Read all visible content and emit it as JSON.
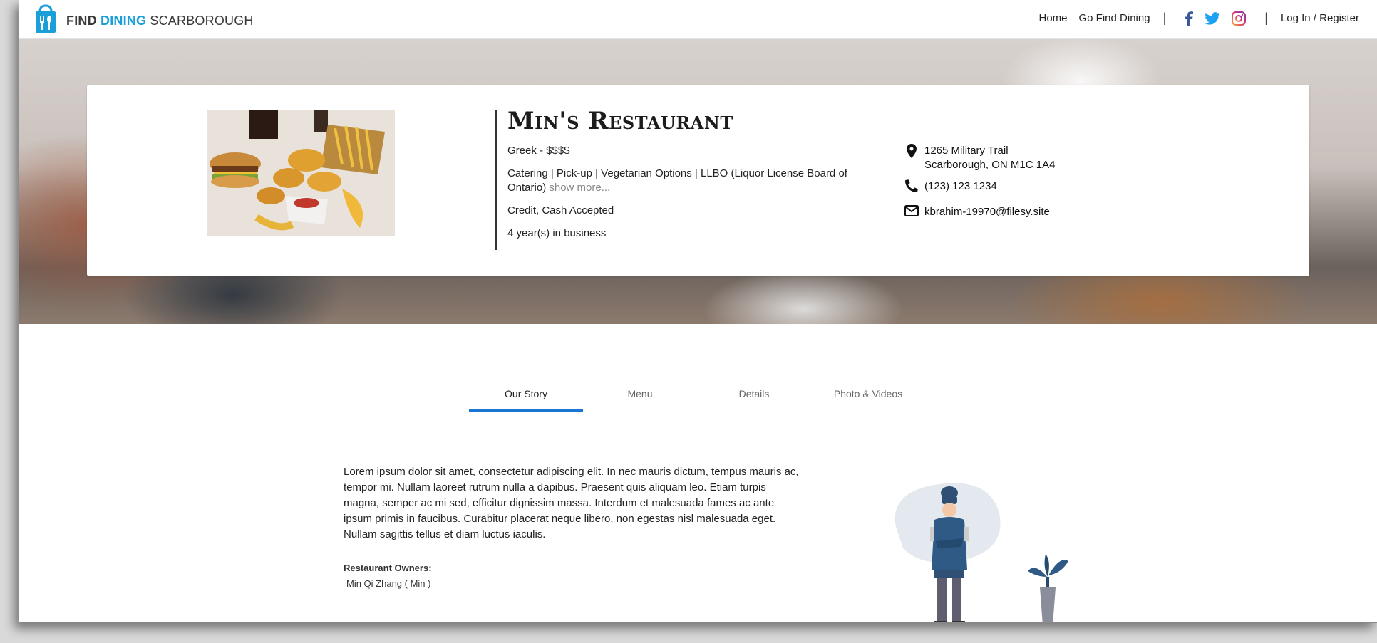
{
  "navbar": {
    "logo": {
      "find": "FIND",
      "dining": "DINING",
      "scarborough": "SCARBOROUGH"
    },
    "links": {
      "home": "Home",
      "go_find_dining": "Go Find Dining",
      "login": "Log In / Register"
    },
    "separator": "|",
    "social_icons": [
      "facebook-icon",
      "twitter-icon",
      "instagram-icon"
    ]
  },
  "restaurant": {
    "name": "Min's Restaurant",
    "cuisine_price": "Greek - $$$$",
    "services": "Catering | Pick-up | Vegetarian Options | LLBO (Liquor License Board of Ontario)",
    "show_more": "show more...",
    "payment": "Credit, Cash Accepted",
    "years": "4 year(s) in business",
    "address_line1": "1265 Military Trail",
    "address_line2": "Scarborough, ON M1C 1A4",
    "phone": "(123) 123 1234",
    "email": "kbrahim-19970@filesy.site"
  },
  "tabs": [
    {
      "label": "Our Story",
      "active": true
    },
    {
      "label": "Menu",
      "active": false
    },
    {
      "label": "Details",
      "active": false
    },
    {
      "label": "Photo & Videos",
      "active": false
    }
  ],
  "story": {
    "text": "Lorem ipsum dolor sit amet, consectetur adipiscing elit. In nec mauris dictum, tempus mauris ac, tempor mi. Nullam laoreet rutrum nulla a dapibus. Praesent quis aliquam leo. Etiam turpis magna, semper ac mi sed, efficitur dignissim massa. Interdum et malesuada fames ac ante ipsum primis in faucibus. Curabitur placerat neque libero, non egestas nisl malesuada eget. Nullam sagittis tellus et diam luctus iaculis.",
    "owners_label": "Restaurant Owners:",
    "owners_name": "Min Qi Zhang ( Min )"
  },
  "colors": {
    "brand_blue": "#1a9fd8",
    "tab_active": "#1976d2",
    "facebook": "#3b5998",
    "twitter": "#1da1f2",
    "instagram": "#c13584"
  }
}
